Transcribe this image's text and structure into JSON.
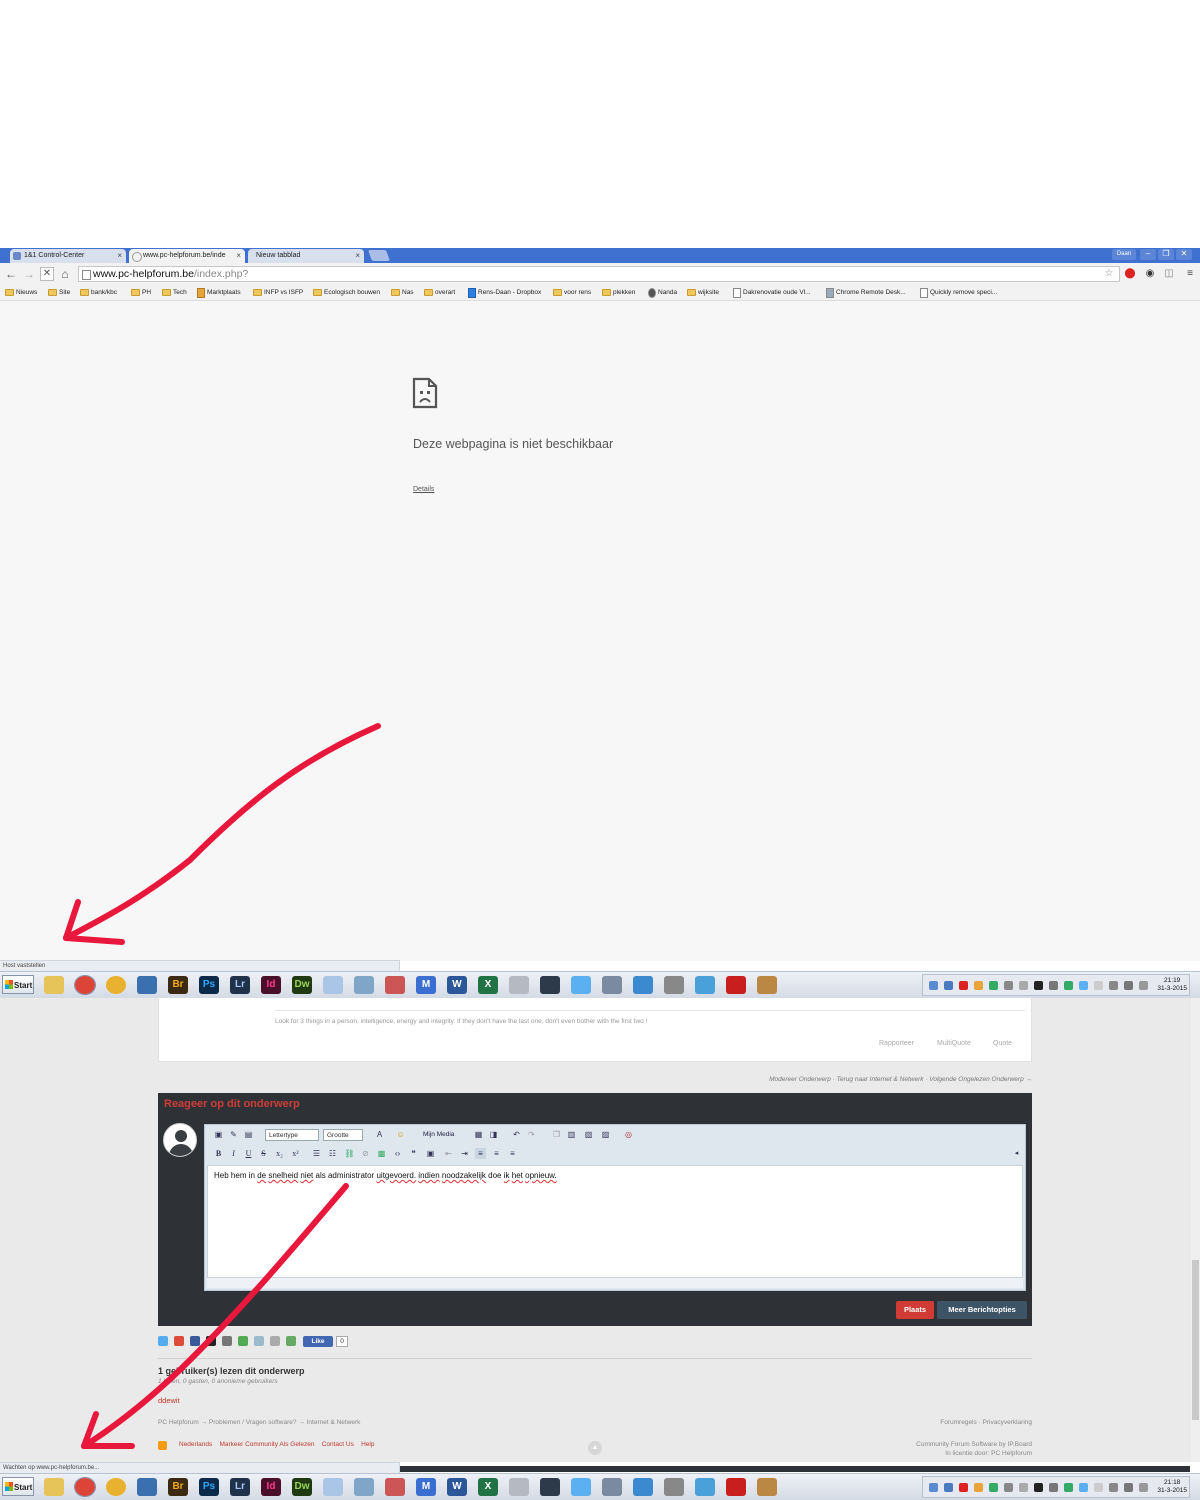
{
  "browser": {
    "tabs": [
      {
        "label": "1&1 Control-Center",
        "active": false
      },
      {
        "label": "www.pc-helpforum.be/inde",
        "active": true
      },
      {
        "label": "Nieuw tabblad",
        "active": false
      }
    ],
    "window_user": "Daan",
    "window_buttons": {
      "minimize": "–",
      "restore": "❐",
      "close": "✕"
    },
    "address": {
      "host": "www.pc-helpforum.be",
      "path": "/index.php?"
    },
    "bookmarks": [
      {
        "label": "Nieuws",
        "icon": "folder-icon"
      },
      {
        "label": "Site",
        "icon": "folder-icon"
      },
      {
        "label": "bank/kbc",
        "icon": "folder-icon"
      },
      {
        "label": "PH",
        "icon": "folder-icon"
      },
      {
        "label": "Tech",
        "icon": "folder-icon"
      },
      {
        "label": "Marktplaats",
        "icon": "marktplaats-icon"
      },
      {
        "label": "INFP vs ISFP",
        "icon": "folder-icon"
      },
      {
        "label": "Ecologisch bouwen",
        "icon": "folder-icon"
      },
      {
        "label": "Nas",
        "icon": "folder-icon"
      },
      {
        "label": "overart",
        "icon": "folder-icon"
      },
      {
        "label": "Rens-Daan - Dropbox",
        "icon": "dropbox-icon"
      },
      {
        "label": "voor rens",
        "icon": "folder-icon"
      },
      {
        "label": "plekken",
        "icon": "folder-icon"
      },
      {
        "label": "Nanda",
        "icon": "person-icon"
      },
      {
        "label": "wijksite",
        "icon": "folder-icon"
      },
      {
        "label": "Dakrenovatie oude Vl...",
        "icon": "page-icon"
      },
      {
        "label": "Chrome Remote Desk...",
        "icon": "remote-desktop-icon"
      },
      {
        "label": "Quickly remove speci...",
        "icon": "page-icon"
      }
    ],
    "error": {
      "title": "Deze webpagina is niet beschikbaar",
      "details_link": "Details"
    },
    "status_top": "Host vaststellen",
    "status_bottom": "Wachten op www.pc-helpforum.be..."
  },
  "taskbar": {
    "start_label": "Start",
    "apps": [
      {
        "name": "explorer",
        "label": ""
      },
      {
        "name": "chrome",
        "label": ""
      },
      {
        "name": "chrome-canary",
        "label": ""
      },
      {
        "name": "thunderbird",
        "label": ""
      },
      {
        "name": "bridge",
        "label": "Br"
      },
      {
        "name": "photoshop",
        "label": "Ps"
      },
      {
        "name": "lightroom",
        "label": "Lr"
      },
      {
        "name": "indesign",
        "label": "Id"
      },
      {
        "name": "dreamweaver",
        "label": "Dw"
      },
      {
        "name": "notepad",
        "label": ""
      },
      {
        "name": "virtualbox",
        "label": ""
      },
      {
        "name": "snipping-tool",
        "label": ""
      },
      {
        "name": "maxthon",
        "label": "M"
      },
      {
        "name": "word",
        "label": "W"
      },
      {
        "name": "excel",
        "label": "X"
      },
      {
        "name": "notes",
        "label": ""
      },
      {
        "name": "1password",
        "label": ""
      },
      {
        "name": "icloud",
        "label": ""
      },
      {
        "name": "remote",
        "label": ""
      },
      {
        "name": "media",
        "label": ""
      },
      {
        "name": "tools",
        "label": ""
      },
      {
        "name": "network",
        "label": ""
      },
      {
        "name": "acrobat",
        "label": ""
      },
      {
        "name": "screen",
        "label": ""
      }
    ],
    "clock_top": {
      "time": "21:19",
      "date": "31-3-2015"
    },
    "clock_bottom": {
      "time": "21:18",
      "date": "31-3-2015"
    }
  },
  "forum": {
    "signature": "Look for 3 things in a person: intelligence, energy and integrity. If they don't have the last one, don't even bother with the first two !",
    "post_actions": [
      "Rapporteer",
      "MultiQuote",
      "Quote"
    ],
    "topic_nav": "Modereer Onderwerp · Terug naar Internet & Netwerk · Volgende Ongelezen Onderwerp →",
    "reply": {
      "title": "Reageer op dit onderwerp",
      "font_select": "Lettertype",
      "size_select": "Grootte",
      "media_label": "Mijn Media",
      "text": "Heb hem in de snelheid niet als administrator uitgevoerd. indien noodzakelijk doe ik het opnieuw.",
      "post_button": "Plaats",
      "more_button": "Meer Berichtopties"
    },
    "fb_like": "Like",
    "fb_count": "0",
    "readers_title": "1 gebruiker(s) lezen dit onderwerp",
    "readers_sub": "1 leden, 0 gasten, 0 anonieme gebruikers",
    "reader_name": "ddewit",
    "breadcrumb": "PC Helpforum → Problemen / Vragen software? → Internet & Netwerk",
    "footer_right": "Forumregels · Privacyverklaring",
    "footer_links": "Nederlands    Markeer Community Als Gelezen    Contact Us    Help",
    "copyright_line1": "Community Forum Software by IP.Board",
    "copyright_line2": "In licentie door: PC Helpforum"
  },
  "colors": {
    "annotation_arrow": "#e8173c",
    "accent_red": "#d03b35",
    "chrome_tabstrip": "#3f71d0"
  }
}
